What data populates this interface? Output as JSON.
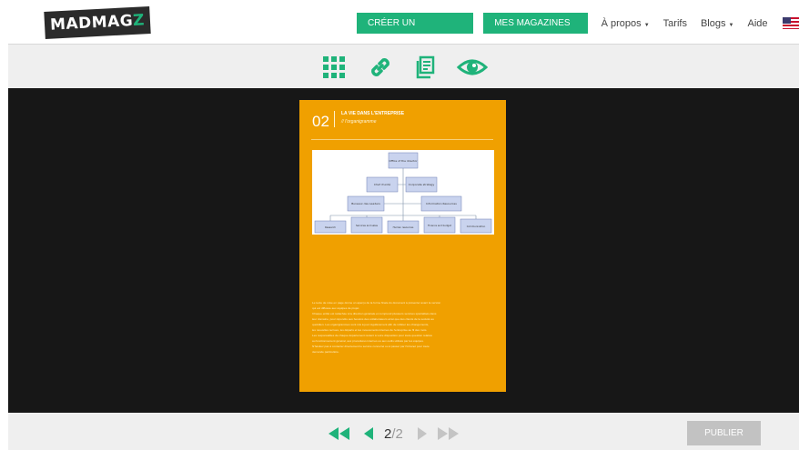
{
  "header": {
    "logo": {
      "text": "MADMAG",
      "accent": "Z"
    },
    "create_button": "CRÉER UN MAGAZINE",
    "my_magazines_button": "MES MAGAZINES",
    "nav": {
      "about": "À propos",
      "pricing": "Tarifs",
      "blogs": "Blogs",
      "help": "Aide"
    },
    "language_flag": "us-flag-icon"
  },
  "toolbar": {
    "icons": [
      "grid-icon",
      "link-icon",
      "pages-icon",
      "eye-icon"
    ]
  },
  "page": {
    "number": "02",
    "title": "LA VIE DANS L'ENTREPRISE",
    "subtitle": "// l'organigramme",
    "org_chart": {
      "top": "Office of the director",
      "level2": [
        "Chef d'unité",
        "Corporate strategy"
      ],
      "level3": [
        "Bureaux des Leaders",
        "Information Resources"
      ],
      "level4": [
        "Research",
        "Services and sales",
        "Human resources",
        "Finance and budget",
        "Communication"
      ]
    },
    "body_lines": [
      "Le texte de mise en page donne un aperçu de la forme finale du document à présenter avant la version",
      "qui est diffusée aux équipes de projet.",
      "Chaque entité est rattachée à la direction générale et comprend plusieurs services spécialisés dans",
      "leur domaine, pour répondre aux besoins des collaborateurs ainsi que des clients de la société au",
      "quotidien. Les organigrammes sont mis à jour régulièrement afin de refléter les changements,",
      "les nouvelles recrues, les départs et les mouvements internes de l'entreprise au fil des mois.",
      "Les responsables de chaque département restent à votre disposition pour toute question relative",
      "au fonctionnement général, aux procédures internes ou aux outils utilisés par les équipes.",
      "N'hésitez pas à contacter directement le service concerné ou à passer par l'intranet pour toute",
      "demande particulière."
    ]
  },
  "pager": {
    "current": "2",
    "separator": "/",
    "total": "2"
  },
  "publish_button": "PUBLIER",
  "colors": {
    "accent": "#1fb37a",
    "page": "#f0a000",
    "stage": "#171717",
    "publish_disabled": "#c2c2c2"
  }
}
